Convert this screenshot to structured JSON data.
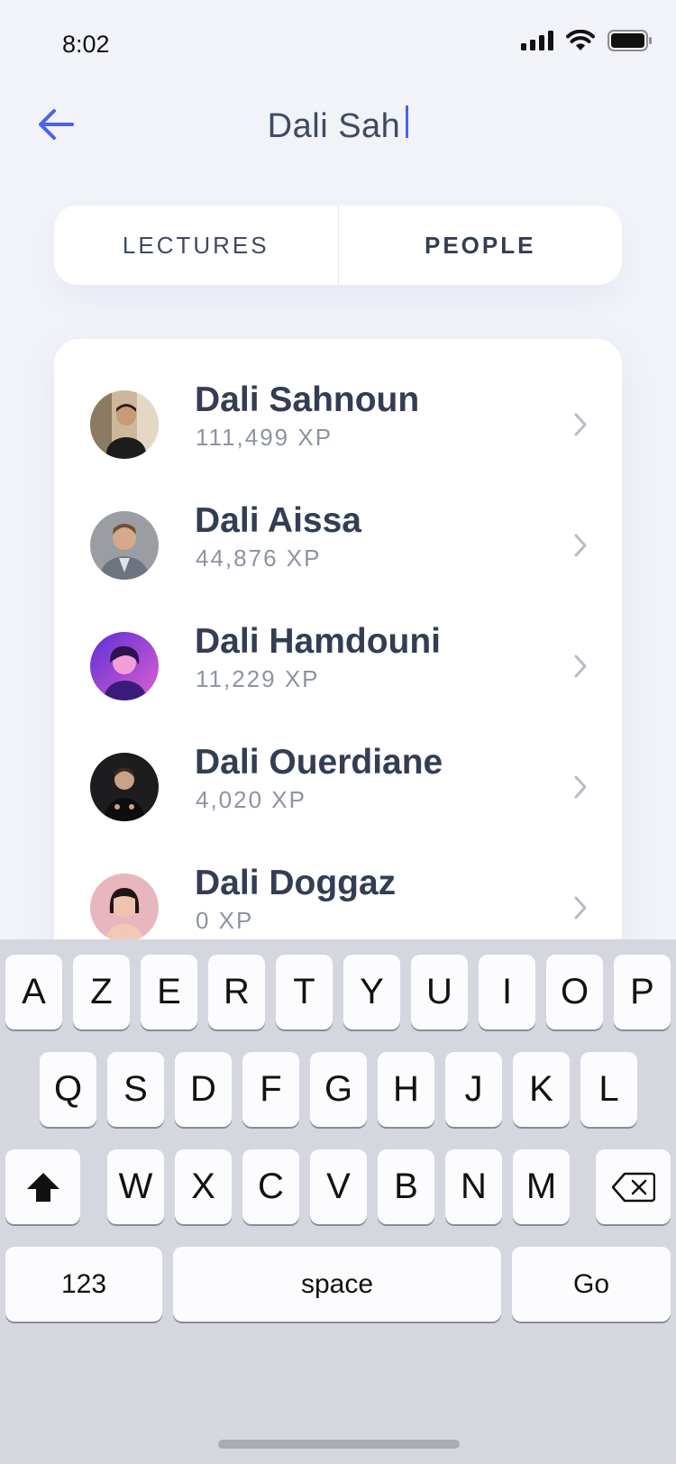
{
  "status": {
    "time": "8:02",
    "icons": [
      "signal-icon",
      "wifi-icon",
      "battery-icon"
    ]
  },
  "header": {
    "back_icon": "arrow-left-icon",
    "search_value": "Dali Sah"
  },
  "tabs": [
    {
      "label": "LECTURES",
      "active": false
    },
    {
      "label": "PEOPLE",
      "active": true
    }
  ],
  "results": [
    {
      "name": "Dali Sahnoun",
      "xp": "111,499 XP"
    },
    {
      "name": "Dali Aissa",
      "xp": "44,876 XP"
    },
    {
      "name": "Dali Hamdouni",
      "xp": "11,229 XP"
    },
    {
      "name": "Dali Ouerdiane",
      "xp": "4,020 XP"
    },
    {
      "name": "Dali Doggaz",
      "xp": "0 XP"
    }
  ],
  "keyboard": {
    "row1": [
      "A",
      "Z",
      "E",
      "R",
      "T",
      "Y",
      "U",
      "I",
      "O",
      "P"
    ],
    "row2": [
      "Q",
      "S",
      "D",
      "F",
      "G",
      "H",
      "J",
      "K",
      "L"
    ],
    "row3": [
      "W",
      "X",
      "C",
      "V",
      "B",
      "N",
      "M"
    ],
    "numbers_label": "123",
    "space_label": "space",
    "go_label": "Go"
  },
  "colors": {
    "accent": "#4a62ef",
    "text": "#333d54",
    "muted": "#8c93a3",
    "background": "#f1f3f9"
  }
}
